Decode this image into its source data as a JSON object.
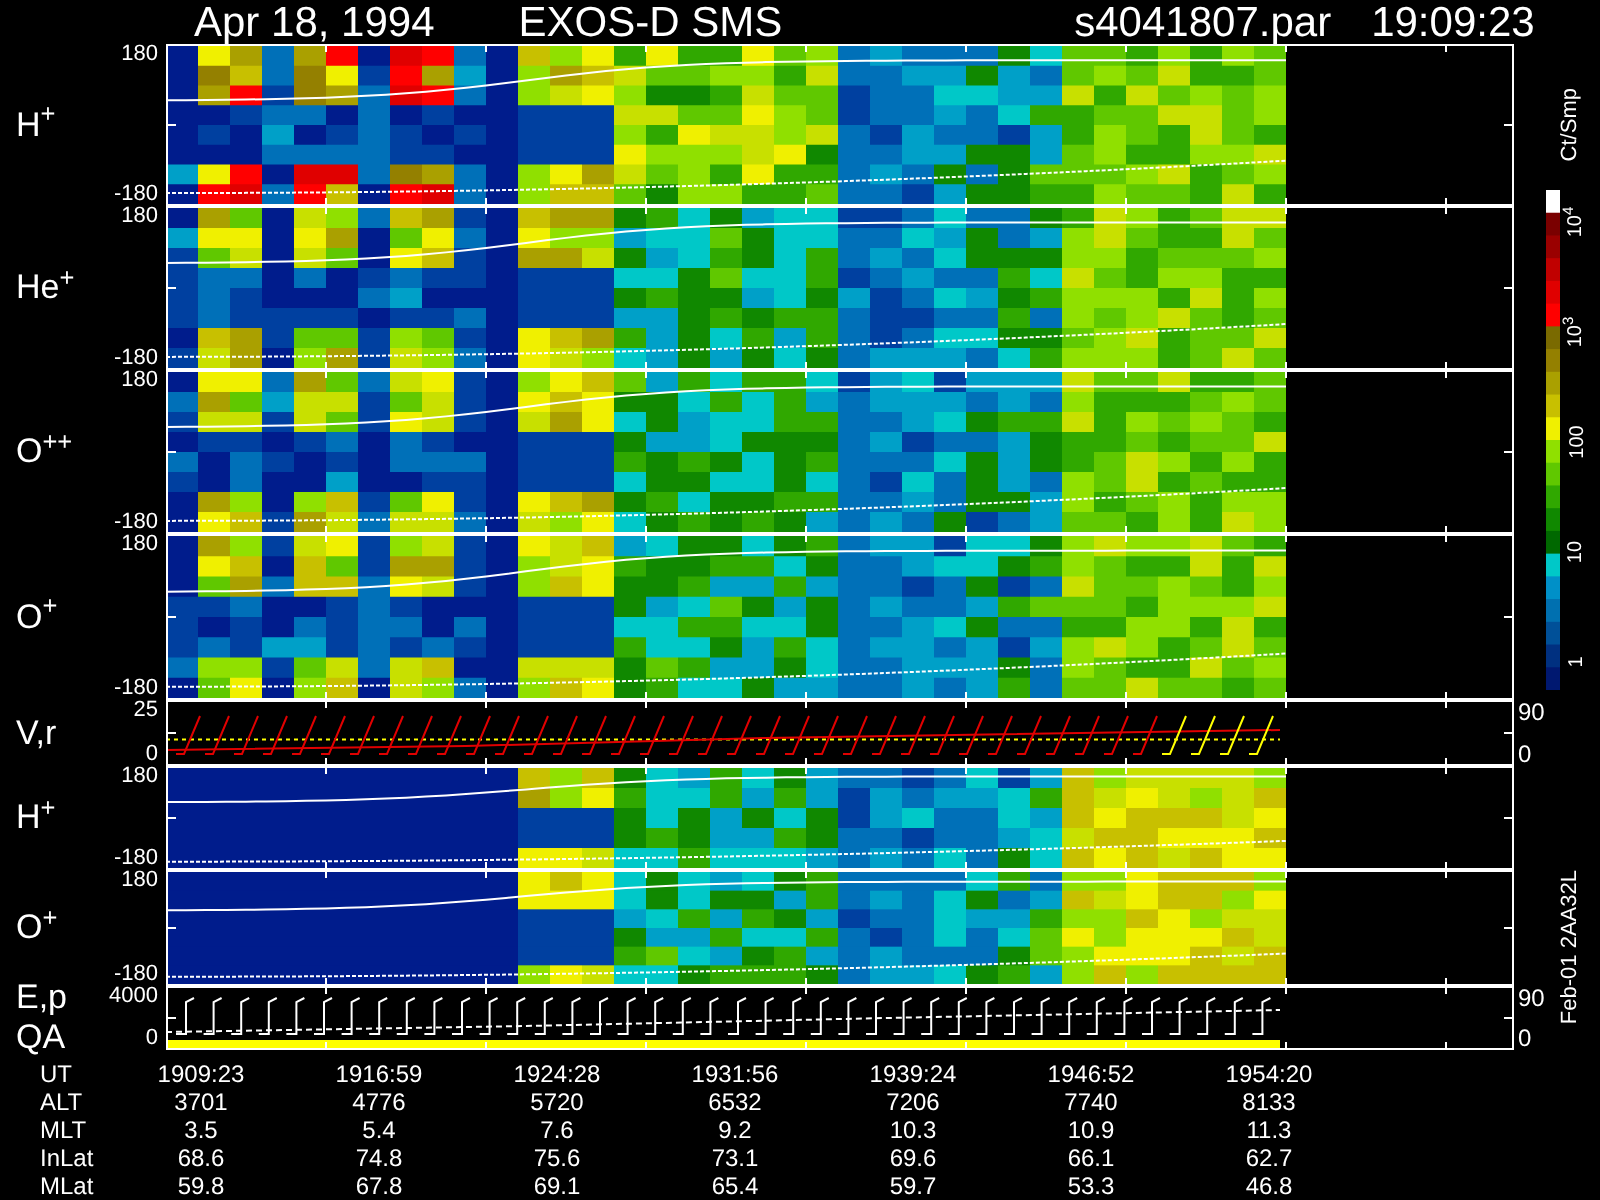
{
  "title": {
    "date": "Apr 18, 1994",
    "instrument": "EXOS-D SMS",
    "file": "s4041807.par",
    "time": "19:09:23"
  },
  "panels": [
    {
      "kind": "spectrogram",
      "labels": [
        "H$^{+}$"
      ],
      "ticks": [
        "180",
        "-180"
      ]
    },
    {
      "kind": "spectrogram",
      "labels": [
        "He$^{+}$"
      ],
      "ticks": [
        "180",
        "-180"
      ]
    },
    {
      "kind": "spectrogram",
      "labels": [
        "O$^{++}$"
      ],
      "ticks": [
        "180",
        "-180"
      ]
    },
    {
      "kind": "spectrogram",
      "labels": [
        "O$^{+}$"
      ],
      "ticks": [
        "180",
        "-180"
      ]
    },
    {
      "kind": "velocity",
      "labels": [
        "V,r"
      ],
      "ticks": [
        "25",
        "0"
      ],
      "right_ticks": [
        "90",
        "0"
      ]
    },
    {
      "kind": "spectrogram",
      "labels": [
        "H$^{+}$"
      ],
      "ticks": [
        "180",
        "-180"
      ]
    },
    {
      "kind": "spectrogram",
      "labels": [
        "O$^{+}$"
      ],
      "ticks": [
        "180",
        "-180"
      ]
    },
    {
      "kind": "energy",
      "labels": [
        "E,p",
        "QA"
      ],
      "ticks": [
        "4000",
        "0"
      ],
      "right_ticks": [
        "90",
        "0"
      ]
    }
  ],
  "color_scale": {
    "unit": "Ct/Smp",
    "ticks": [
      "10$^{4}$",
      "10$^{3}$",
      "100",
      "10",
      "1"
    ]
  },
  "footer_code": "Feb-01 2AA32L",
  "table": {
    "rows": [
      {
        "label": "UT",
        "values": [
          "1909:23",
          "1916:59",
          "1924:28",
          "1931:56",
          "1939:24",
          "1946:52",
          "1954:20"
        ]
      },
      {
        "label": "ALT",
        "values": [
          "3701",
          "4776",
          "5720",
          "6532",
          "7206",
          "7740",
          "8133"
        ]
      },
      {
        "label": "MLT",
        "values": [
          "3.5",
          "5.4",
          "7.6",
          "9.2",
          "10.3",
          "10.9",
          "11.3"
        ]
      },
      {
        "label": "InLat",
        "values": [
          "68.6",
          "74.8",
          "75.6",
          "73.1",
          "69.6",
          "66.1",
          "62.7"
        ]
      },
      {
        "label": "MLat",
        "values": [
          "59.8",
          "67.8",
          "69.1",
          "65.4",
          "59.7",
          "53.3",
          "46.8"
        ]
      }
    ]
  }
}
